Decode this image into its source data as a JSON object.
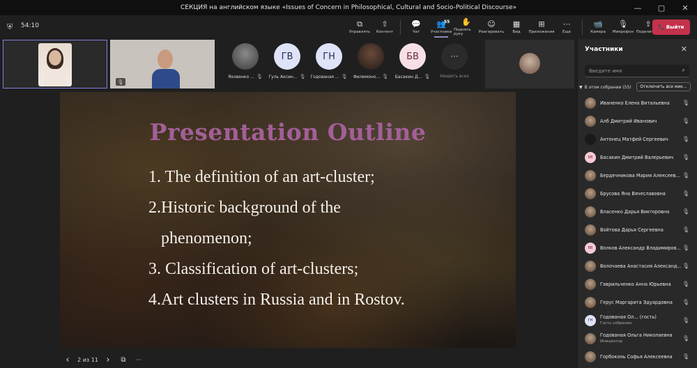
{
  "window": {
    "title": "СЕКЦИЯ на английском языке «Issues of Concern in Philosophical, Cultural and Socio-Political Discourse»",
    "controls": [
      "—",
      "▢",
      "✕"
    ]
  },
  "toolbar": {
    "timer": "54:10",
    "buttons": [
      {
        "label": "Управлять",
        "icon": "⧉"
      },
      {
        "label": "Контент",
        "icon": "⇧"
      },
      {
        "label": "Чат",
        "icon": "💬"
      },
      {
        "label": "Участники",
        "icon": "👥",
        "badge": "55"
      },
      {
        "label": "Поднять руку",
        "icon": "✋"
      },
      {
        "label": "Реагировать",
        "icon": "☺"
      },
      {
        "label": "Вид",
        "icon": "▦"
      },
      {
        "label": "Приложения",
        "icon": "⊞"
      },
      {
        "label": "Еще",
        "icon": "⋯"
      },
      {
        "label": "Камера",
        "icon": "📹"
      },
      {
        "label": "Микрофон",
        "icon": "🎙"
      },
      {
        "label": "Поделиться",
        "icon": "⇪"
      }
    ],
    "leave_label": "Выйти"
  },
  "video_row": {
    "avatars": [
      {
        "name": "Яковенко ...",
        "initials": ""
      },
      {
        "name": "Гуль Аксин...",
        "initials": "ГВ"
      },
      {
        "name": "Годованая ...",
        "initials": "ГН"
      },
      {
        "name": "Филимоно...",
        "initials": ""
      },
      {
        "name": "Басакин Д...",
        "initials": "БВ"
      },
      {
        "name": "Увидеть всех",
        "initials": "···"
      }
    ]
  },
  "slide": {
    "title": "Presentation Outline",
    "bullets": [
      "1. The definition of an art-cluster;",
      "2.Historic background of the",
      "phenomenon;",
      "3. Classification of art-clusters;",
      "4.Art clusters in Russia and in Rostov."
    ]
  },
  "slide_nav": {
    "prev": "‹",
    "position": "2 из 11",
    "next": "›",
    "more": "···"
  },
  "participants_panel": {
    "title": "Участники",
    "search_placeholder": "Введите имя",
    "group_label": "В этом собрании (55)",
    "mute_all": "Отключить все мик...",
    "people": [
      {
        "name": "Иваненко Елена Витальевна",
        "sub": "",
        "initials": ""
      },
      {
        "name": "Алб Дмитрий Иванович",
        "sub": "",
        "initials": ""
      },
      {
        "name": "Антонец Матфей Сергеевич",
        "sub": "",
        "initials": ""
      },
      {
        "name": "Басакин Дмитрий Валерьевич",
        "sub": "",
        "initials": "БВ"
      },
      {
        "name": "Бердечникова Мария Алексеев...",
        "sub": "",
        "initials": ""
      },
      {
        "name": "Брусова Яна Вячеславовна",
        "sub": "",
        "initials": ""
      },
      {
        "name": "Власенко Дарья Викторовна",
        "sub": "",
        "initials": ""
      },
      {
        "name": "Войтова Дарья Сергеевна",
        "sub": "",
        "initials": ""
      },
      {
        "name": "Волков Александр Владимиров...",
        "sub": "",
        "initials": "ВВ"
      },
      {
        "name": "Волочаева Анастасия Александ...",
        "sub": "",
        "initials": ""
      },
      {
        "name": "Гаврильченко Анна Юрьевна",
        "sub": "",
        "initials": ""
      },
      {
        "name": "Герус Маргарита Эдуардовна",
        "sub": "",
        "initials": ""
      },
      {
        "name": "Годованая Ол... (гость)",
        "sub": "Гость собрания",
        "initials": "ГН"
      },
      {
        "name": "Годованая Ольга Николаевна",
        "sub": "Инициатор",
        "initials": ""
      },
      {
        "name": "Горбоконь Софья Алексеевна",
        "sub": "",
        "initials": ""
      }
    ]
  },
  "colors": {
    "accent": "#7b7fe0",
    "leave": "#c4314b",
    "slide_title": "#a35f98"
  }
}
